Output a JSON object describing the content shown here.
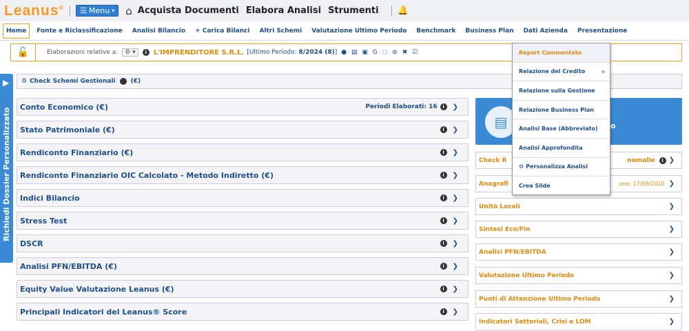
{
  "topbar": {
    "logo": "Leanus",
    "logo_mark": "®",
    "menu_label": "Menu",
    "links": [
      "Acquista Documenti",
      "Elabora Analisi",
      "Strumenti"
    ]
  },
  "navbar": {
    "home": "Home",
    "items": [
      "Fonte e Riclassificazione",
      "Analisi Bilancio",
      "+ Carica Bilanci",
      "Altri Schemi",
      "Valutazione Ultimo Periodo",
      "Benchmark",
      "Business Plan",
      "Dati Azienda",
      "Presentazione"
    ]
  },
  "context": {
    "label": "Elaborazioni relative a:",
    "company": "L'IMPRENDITORE S.R.L.",
    "period_prefix": "[Ultimo Periodo: ",
    "period_value": "8/2024 (8)",
    "period_suffix": "]"
  },
  "sidetab": {
    "label": "Richiedi Dossier Personalizzato"
  },
  "check_row": {
    "label": "Check Schemi Gestionali",
    "unit": "(€)"
  },
  "panels": [
    {
      "title": "Conto Economico (€)",
      "extra": "Periodi Elaborati: 16"
    },
    {
      "title": "Stato Patrimoniale (€)",
      "extra": ""
    },
    {
      "title": "Rendiconto Finanziario (€)",
      "extra": ""
    },
    {
      "title": "Rendiconto Finanziario OIC Calcolato - Metodo Indiretto (€)",
      "extra": ""
    },
    {
      "title": "Indici Bilancio",
      "extra": ""
    },
    {
      "title": "Stress Test",
      "extra": ""
    },
    {
      "title": "DSCR",
      "extra": ""
    },
    {
      "title": "Analisi PFN/EBITDA (€)",
      "extra": ""
    },
    {
      "title": "Equity Value Valutazione Leanus (€)",
      "extra": ""
    },
    {
      "title": "Principali Indicatori del Leanus® Score",
      "extra": ""
    }
  ],
  "promo": {
    "text": "o"
  },
  "right_panels": [
    {
      "title": "Check R",
      "right": "nomalie"
    },
    {
      "title": "Anagrafi",
      "right": "one: 17/09/2010"
    },
    {
      "title": "Unità Locali",
      "right": ""
    },
    {
      "title": "Sintesi Eco/Fin",
      "right": ""
    },
    {
      "title": "Analisi PFN/EBITDA",
      "right": ""
    },
    {
      "title": "Valutazione Ultimo Periodo",
      "right": ""
    },
    {
      "title": "Punti di Attenzione Ultimo Periodo",
      "right": ""
    },
    {
      "title": "Indicatori Settoriali, Crisi e LOM",
      "right": ""
    }
  ],
  "dropdown": {
    "items": [
      "Report Commentato",
      "Relazione del Credito",
      "Relazione sulla Gestione",
      "Relazione Business Plan",
      "Analisi Base (Abbreviato)",
      "Analisi Approfondita",
      "Personalizza Analisi",
      "Crea Slide"
    ]
  }
}
